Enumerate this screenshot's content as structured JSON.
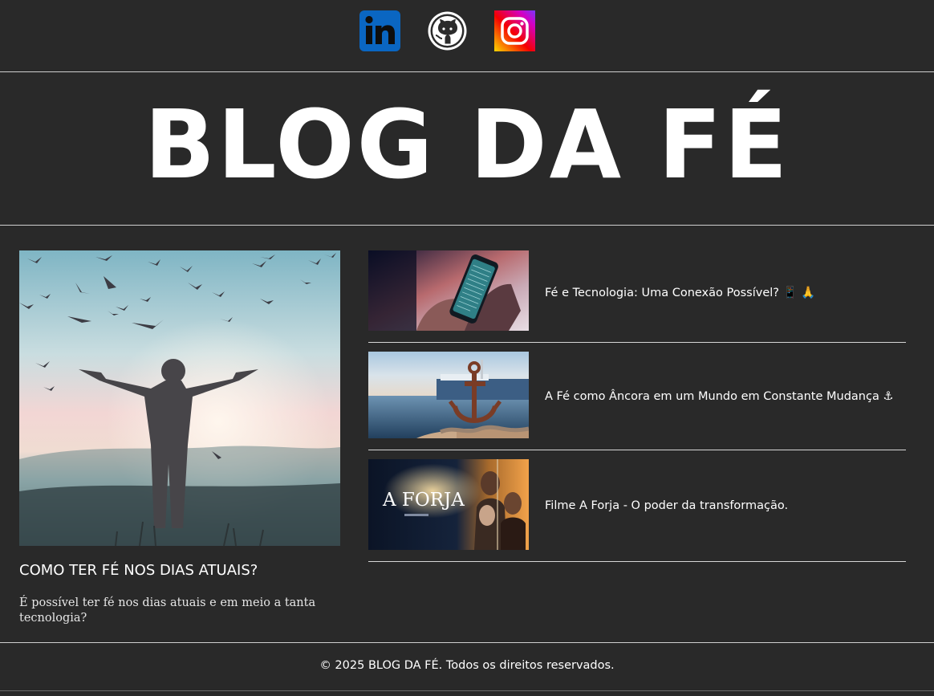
{
  "social": {
    "linkedin": {
      "icon": "linkedin-icon",
      "color": "#0a66c2"
    },
    "github": {
      "icon": "github-icon",
      "color": "#ffffff"
    },
    "instagram": {
      "icon": "instagram-icon",
      "colors": [
        "#fcd800",
        "#f50000",
        "#d300c5",
        "#7638fa"
      ]
    }
  },
  "header": {
    "title": "BLOG DA FÉ"
  },
  "featured": {
    "title": "COMO TER FÉ NOS DIAS ATUAIS?",
    "excerpt": "É possível ter fé nos dias atuais e em meio a tanta tecnologia?"
  },
  "posts": [
    {
      "title": "Fé e Tecnologia: Uma Conexão Possível? 📱 🙏"
    },
    {
      "title": "A Fé como Âncora em um Mundo em Constante Mudança ⚓"
    },
    {
      "title": "Filme A Forja - O poder da transformação.",
      "thumb_text": "A FORJA"
    }
  ],
  "footer": {
    "text": "© 2025 BLOG DA FÉ. Todos os direitos reservados."
  },
  "colors": {
    "background": "#292929",
    "text": "#ffffff",
    "divider": "#cfcfcf"
  }
}
